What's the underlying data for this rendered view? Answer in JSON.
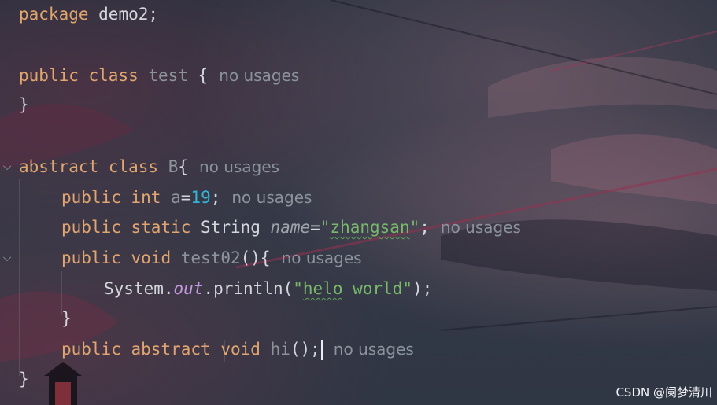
{
  "editor": {
    "hint_text": "no usages",
    "fold_icon": "⌵",
    "line1": {
      "package_kw": "package",
      "package_name": " demo2;"
    },
    "line3": {
      "public_kw": "public",
      "class_kw": "class",
      "class_name": "test",
      "brace": " {"
    },
    "line4": {
      "close": "}"
    },
    "line6": {
      "abstract_kw": "abstract",
      "class_kw": "class",
      "class_name": "B",
      "brace": "{"
    },
    "line7": {
      "public_kw": "public",
      "int_kw": "int",
      "field": "a",
      "eq": "=",
      "value": "19",
      "semi": ";"
    },
    "line8": {
      "public_kw": "public",
      "static_kw": "static",
      "type": "String",
      "field": "name",
      "eq": "=",
      "q1": "\"",
      "value": "zhangsan",
      "q2": "\"",
      "semi": ";"
    },
    "line9": {
      "public_kw": "public",
      "void_kw": "void",
      "method": "test02",
      "tail": "(){"
    },
    "line10": {
      "system": "System.",
      "out": "out",
      "println": ".println(",
      "q1": "\"",
      "word1": "helo",
      "word2": " world",
      "q2": "\"",
      "tail": ");"
    },
    "line11": {
      "close": "}"
    },
    "line12": {
      "public_kw": "public",
      "abstract_kw": "abstract",
      "void_kw": "void",
      "method": "hi",
      "tail": "();"
    },
    "line13": {
      "close": "}"
    }
  },
  "watermark": {
    "text": "CSDN @阑梦清川"
  },
  "colors": {
    "keyword": "#e1a56e",
    "number": "#2fb6d6",
    "string": "#77b86a",
    "static_field": "#c39adf",
    "hint": "#8b939c"
  }
}
